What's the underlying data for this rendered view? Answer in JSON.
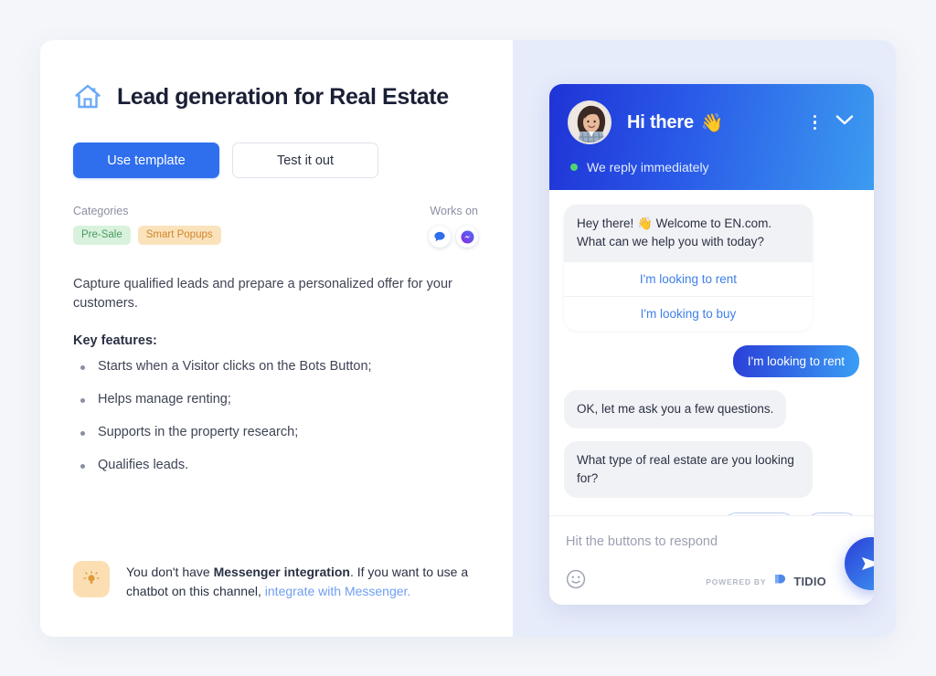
{
  "template": {
    "icon": "home-icon",
    "title": "Lead generation for Real Estate",
    "primary_button": "Use template",
    "secondary_button": "Test it out",
    "categories_label": "Categories",
    "categories": [
      {
        "label": "Pre-Sale",
        "style": "green"
      },
      {
        "label": "Smart Popups",
        "style": "orange"
      }
    ],
    "works_on_label": "Works on",
    "works_on": [
      {
        "name": "live-chat-icon"
      },
      {
        "name": "messenger-icon"
      }
    ],
    "description": "Capture qualified leads and prepare a personalized offer for your customers.",
    "key_features_label": "Key features:",
    "features": [
      "Starts when a Visitor clicks on the Bots Button;",
      "Helps manage renting;",
      "Supports in the property research;",
      "Qualifies leads."
    ],
    "notice": {
      "icon": "lightbulb-icon",
      "text_before": "You don't have ",
      "bold": "Messenger integration",
      "text_middle": ". If you want to use a chatbot on this channel, ",
      "link": "integrate with Messenger."
    }
  },
  "widget": {
    "avatar": "agent-avatar",
    "greeting": "Hi there",
    "greeting_emoji": "👋",
    "menu_icon": "kebab-menu-icon",
    "minimize_icon": "chevron-down-icon",
    "status": "We reply immediately",
    "messages": [
      {
        "type": "bot-card",
        "text": "Hey there! 👋 Welcome to EN.com. What can we help you with today?",
        "options": [
          "I'm looking to rent",
          "I'm looking to buy"
        ]
      },
      {
        "type": "user",
        "text": "I'm looking to rent"
      },
      {
        "type": "bot",
        "text": "OK, let me ask you a few questions."
      },
      {
        "type": "bot",
        "text": "What type of real estate are you looking for?"
      }
    ],
    "choices": [
      "",
      ""
    ],
    "input_placeholder": "Hit the buttons to respond",
    "emoji_icon": "smiley-icon",
    "powered_by_label": "POWERED BY",
    "powered_by_brand": "TIDIO",
    "send_icon": "send-icon"
  },
  "colors": {
    "accent": "#2f6fed",
    "page_bg": "#f4f6fa",
    "panel_bg": "#e7ecfb",
    "tag_green_bg": "#d9f2dd",
    "tag_green_fg": "#4a9a5e",
    "tag_orange_bg": "#fae3bc",
    "tag_orange_fg": "#d1852a",
    "online_dot": "#4fd66f"
  }
}
